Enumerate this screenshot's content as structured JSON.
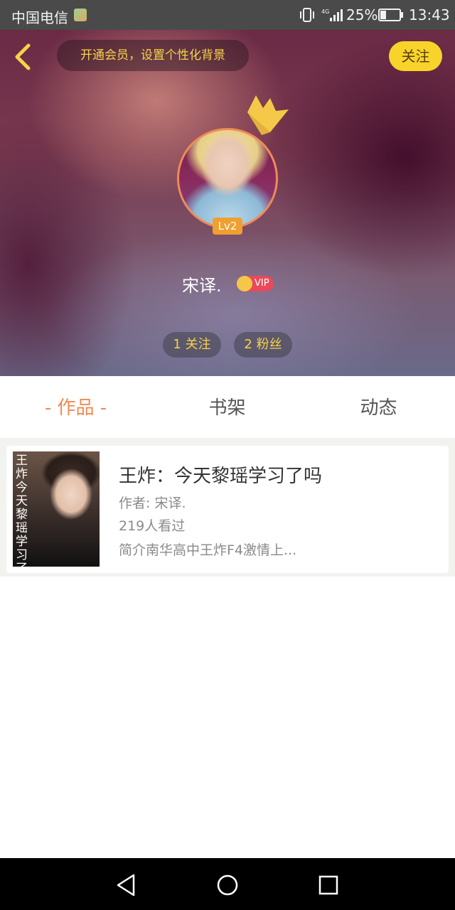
{
  "status_bar": {
    "carrier": "中国电信",
    "battery": "25%",
    "time": "13:43",
    "signal_label": "4G"
  },
  "header": {
    "vip_banner": "开通会员，设置个性化背景",
    "follow_button": "关注",
    "level": "Lv2",
    "username": "宋译.",
    "vip_label": "VIP",
    "following": "1 关注",
    "fans": "2 粉丝"
  },
  "tabs": {
    "works": "- 作品 -",
    "bookshelf": "书架",
    "activity": "动态"
  },
  "book": {
    "title": "王炸：今天黎瑶学习了吗",
    "author": "作者: 宋译.",
    "views": "219人看过",
    "intro": "简介南华高中王炸F4激情上..."
  },
  "colors": {
    "accent_yellow": "#f8d42a",
    "tab_active": "#ef8a50",
    "vip_red": "#e84a5a"
  },
  "icons": [
    "back-arrow-icon",
    "crown-icon",
    "vip-crown-icon",
    "nav-back-icon",
    "nav-home-icon",
    "nav-recent-icon"
  ]
}
